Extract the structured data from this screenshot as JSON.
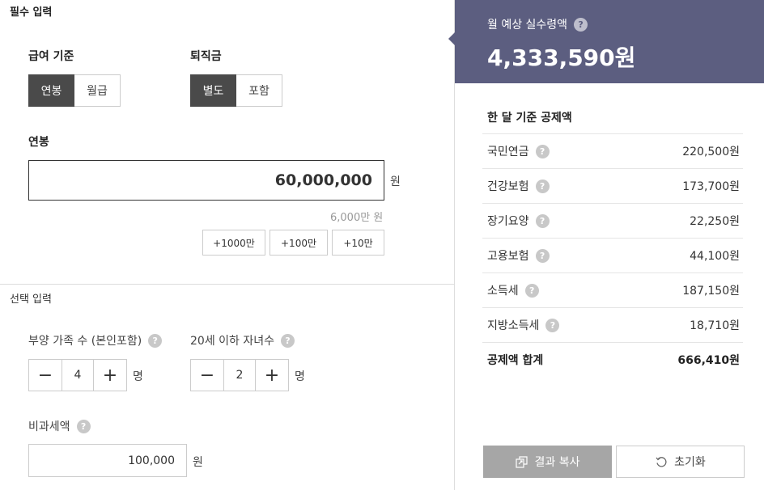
{
  "required": {
    "section_title": "필수 입력",
    "pay_basis": {
      "label": "급여 기준",
      "options": [
        "연봉",
        "월급"
      ],
      "selected": "연봉"
    },
    "severance": {
      "label": "퇴직금",
      "options": [
        "별도",
        "포함"
      ],
      "selected": "별도"
    },
    "salary": {
      "label": "연봉",
      "value": "60,000,000",
      "unit": "원",
      "helper": "6,000만 원"
    },
    "quick_buttons": [
      "+1000만",
      "+100만",
      "+10만"
    ]
  },
  "optional": {
    "section_title": "선택 입력",
    "dependents": {
      "label": "부양 가족 수 (본인포함)",
      "value": "4",
      "unit": "명"
    },
    "children": {
      "label": "20세 이하 자녀수",
      "value": "2",
      "unit": "명"
    },
    "nontax": {
      "label": "비과세액",
      "value": "100,000",
      "unit": "원"
    }
  },
  "result": {
    "title": "월 예상 실수령액",
    "amount": "4,333,590원",
    "deduction_title": "한 달 기준 공제액",
    "deductions": [
      {
        "name": "국민연금",
        "value": "220,500원"
      },
      {
        "name": "건강보험",
        "value": "173,700원"
      },
      {
        "name": "장기요양",
        "value": "22,250원"
      },
      {
        "name": "고용보험",
        "value": "44,100원"
      },
      {
        "name": "소득세",
        "value": "187,150원"
      },
      {
        "name": "지방소득세",
        "value": "18,710원"
      }
    ],
    "total": {
      "name": "공제액 합계",
      "value": "666,410원"
    },
    "copy_label": "결과 복사",
    "reset_label": "초기화"
  },
  "icons": {
    "help": "?",
    "minus": "−",
    "plus": "+"
  },
  "colors": {
    "header_bg": "#5c5e80",
    "active_seg": "#4a4a4a",
    "copy_button": "#a6a6a6"
  }
}
